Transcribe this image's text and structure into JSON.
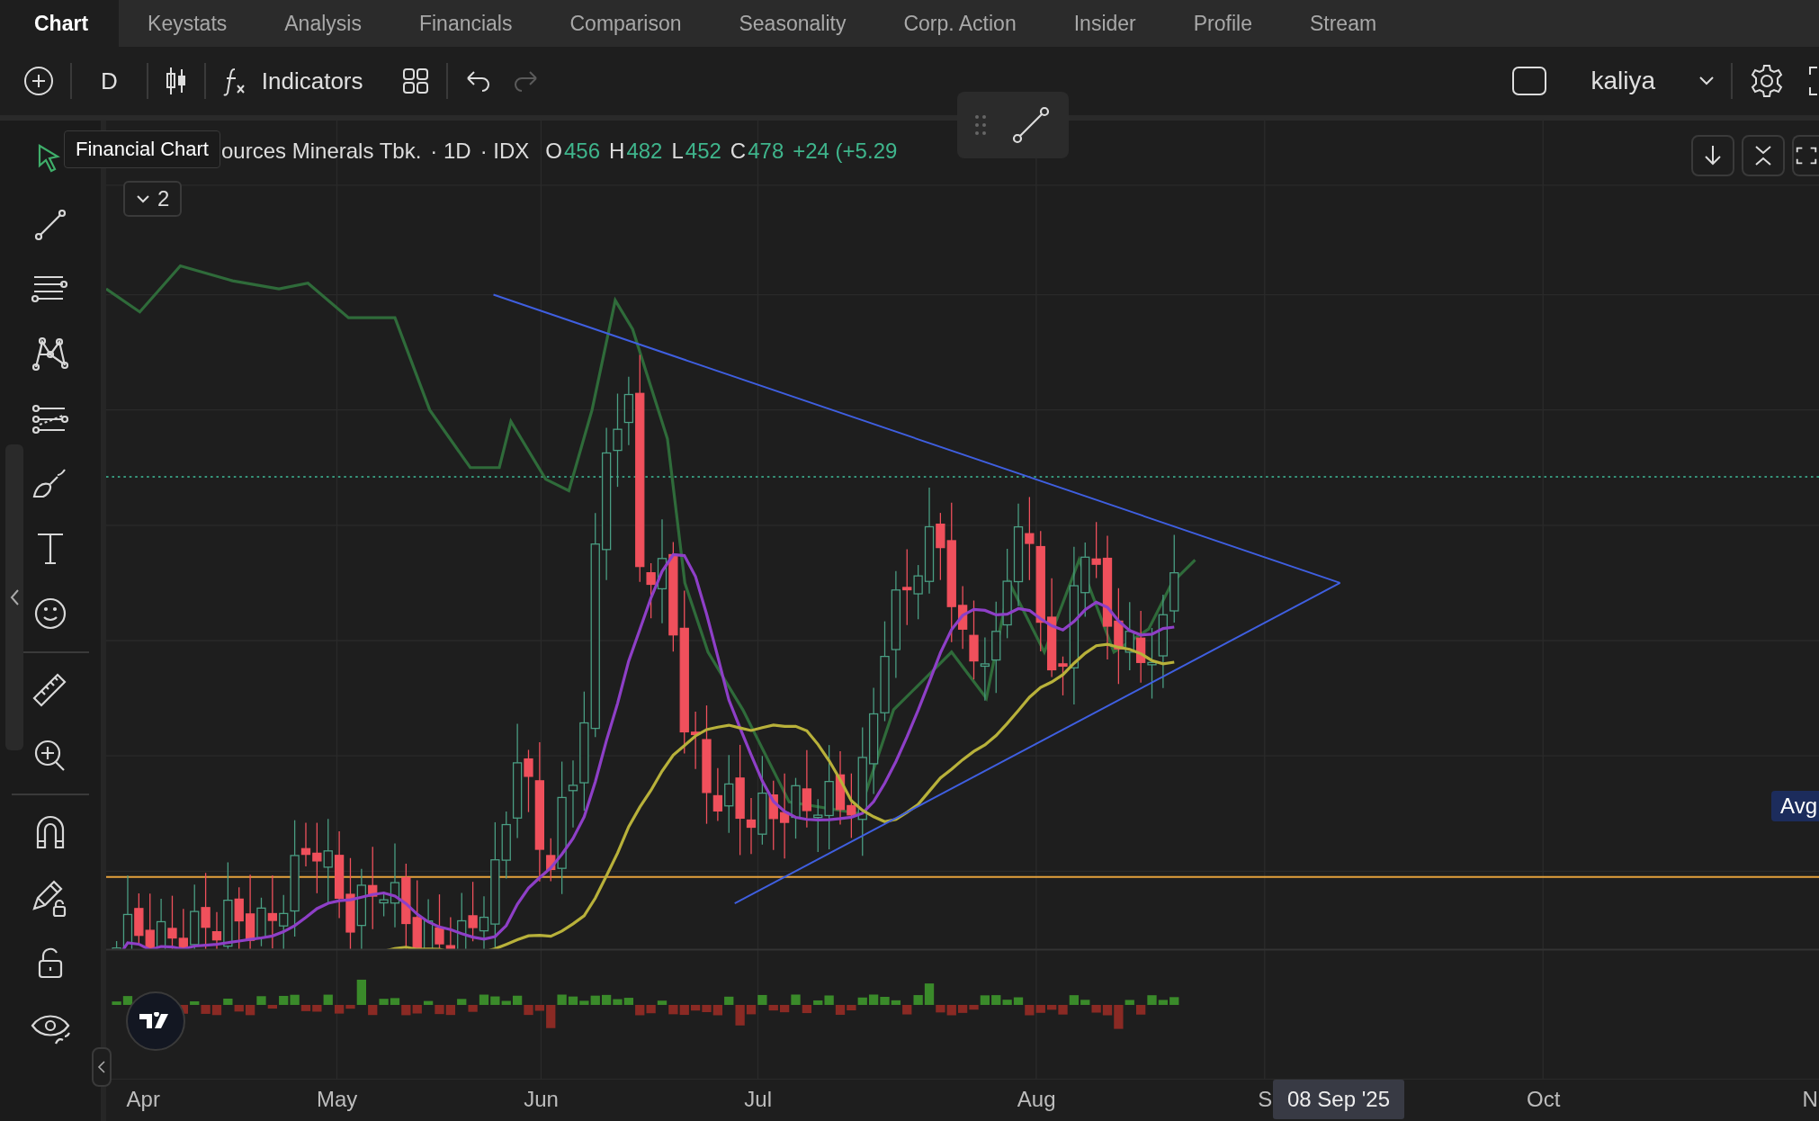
{
  "tabs": [
    {
      "label": "Chart",
      "selected": true
    },
    {
      "label": "Keystats",
      "selected": false
    },
    {
      "label": "Analysis",
      "selected": false
    },
    {
      "label": "Financials",
      "selected": false
    },
    {
      "label": "Comparison",
      "selected": false
    },
    {
      "label": "Seasonality",
      "selected": false
    },
    {
      "label": "Corp. Action",
      "selected": false
    },
    {
      "label": "Insider",
      "selected": false
    },
    {
      "label": "Profile",
      "selected": false
    },
    {
      "label": "Stream",
      "selected": false
    }
  ],
  "toolbar": {
    "interval": "D",
    "indicators": "Indicators",
    "redo_disabled": true,
    "layout_name": "kaliya"
  },
  "left_toolbar": {
    "tools": [
      {
        "kind": "cursor",
        "selected": true
      },
      {
        "kind": "trendline",
        "selected": false
      },
      {
        "kind": "fib",
        "selected": false
      },
      {
        "kind": "pattern",
        "selected": false
      },
      {
        "kind": "forecast",
        "selected": false
      },
      {
        "kind": "brush",
        "selected": false
      },
      {
        "kind": "text",
        "selected": false
      },
      {
        "kind": "emoji",
        "selected": false
      },
      {
        "kind": "ruler",
        "selected": false
      },
      {
        "kind": "zoom",
        "selected": false
      },
      {
        "kind": "magnet",
        "selected": false
      },
      {
        "kind": "lockdraw",
        "selected": false
      },
      {
        "kind": "lock",
        "selected": false
      },
      {
        "kind": "eye",
        "selected": false
      }
    ]
  },
  "tooltip": "Financial Chart",
  "legend": {
    "symbol": "ources Minerals Tbk.",
    "interval": "· 1D",
    "exchange": "· IDX",
    "ohlc": [
      {
        "letter": "O",
        "value": "456"
      },
      {
        "letter": "H",
        "value": "482"
      },
      {
        "letter": "L",
        "value": "452"
      },
      {
        "letter": "C",
        "value": "478"
      }
    ],
    "change": "+24 (+5.29",
    "indicator_count": "2"
  },
  "price_label": "Avg",
  "x_axis": {
    "labels": [
      "Apr",
      "May",
      "Jun",
      "Jul",
      "Aug",
      "S",
      "Oct",
      "N"
    ],
    "crosshair_date": "08 Sep '25"
  }
}
